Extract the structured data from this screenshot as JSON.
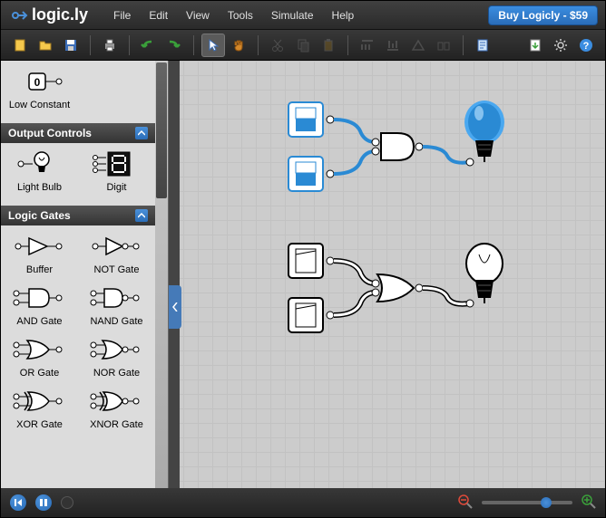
{
  "app": {
    "name": "logic.ly"
  },
  "menu": {
    "file": "File",
    "edit": "Edit",
    "view": "View",
    "tools": "Tools",
    "simulate": "Simulate",
    "help": "Help"
  },
  "buy_button": "Buy Logicly - $59",
  "toolbar": {
    "new": "new-file",
    "open": "open-file",
    "save": "save",
    "print": "print",
    "undo": "undo",
    "redo": "redo",
    "pointer": "pointer",
    "pan": "pan",
    "cut": "cut",
    "copy": "copy",
    "paste": "paste",
    "alignL": "align-left",
    "alignC": "align-center",
    "alignR": "align-right",
    "alignJ": "align-justify",
    "notes": "notes",
    "export": "export",
    "settings": "settings",
    "help": "help"
  },
  "sidebar": {
    "input_controls": {
      "items": [
        {
          "label": "Low Constant",
          "icon": "low-constant"
        }
      ]
    },
    "output_controls": {
      "header": "Output Controls",
      "items": [
        {
          "label": "Light Bulb",
          "icon": "light-bulb"
        },
        {
          "label": "Digit",
          "icon": "seven-segment"
        }
      ]
    },
    "logic_gates": {
      "header": "Logic Gates",
      "items": [
        {
          "label": "Buffer",
          "icon": "buffer"
        },
        {
          "label": "NOT Gate",
          "icon": "not"
        },
        {
          "label": "AND Gate",
          "icon": "and"
        },
        {
          "label": "NAND Gate",
          "icon": "nand"
        },
        {
          "label": "OR Gate",
          "icon": "or"
        },
        {
          "label": "NOR Gate",
          "icon": "nor"
        },
        {
          "label": "XOR Gate",
          "icon": "xor"
        },
        {
          "label": "XNOR Gate",
          "icon": "xnor"
        }
      ]
    }
  },
  "canvas": {
    "circuits": [
      {
        "id": "circuit-a",
        "state": "on",
        "sw1": "on",
        "sw2": "on",
        "gate": "and",
        "bulb": "on"
      },
      {
        "id": "circuit-b",
        "state": "off",
        "sw1": "off",
        "sw2": "off",
        "gate": "or",
        "bulb": "off"
      }
    ],
    "colors": {
      "wire_on": "#2a8ad4",
      "wire_off": "#ffffff",
      "stroke": "#000000",
      "grid": "#cccccc"
    }
  },
  "status": {
    "zoom_percent": 65
  }
}
